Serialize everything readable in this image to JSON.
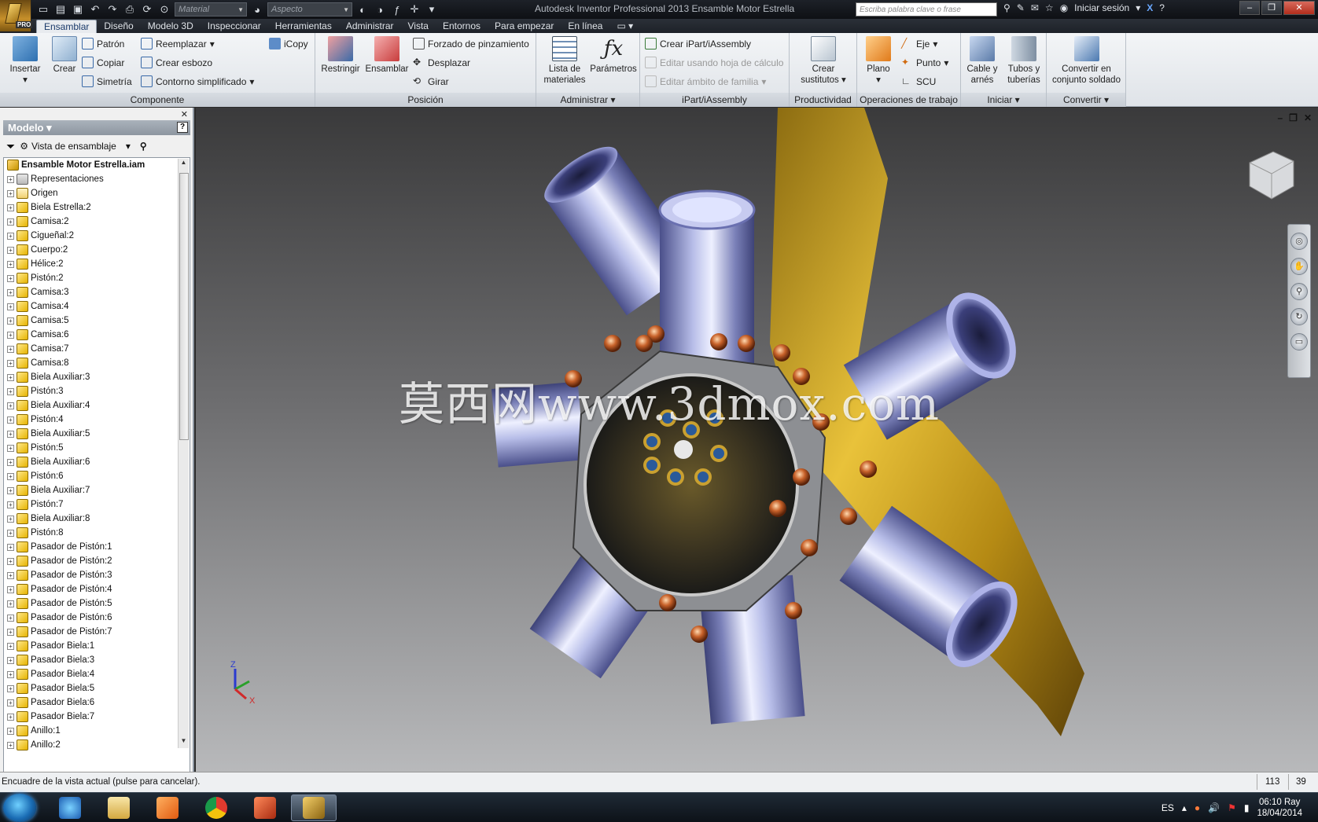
{
  "window": {
    "title": "Autodesk Inventor Professional 2013    Ensamble Motor Estrella",
    "app_badge": "PRO",
    "material_placeholder": "Material",
    "appearance_placeholder": "Aspecto",
    "search_placeholder": "Escriba palabra clave o frase",
    "sign_in": "Iniciar sesión"
  },
  "tabs": [
    "Ensamblar",
    "Diseño",
    "Modelo 3D",
    "Inspeccionar",
    "Herramientas",
    "Administrar",
    "Vista",
    "Entornos",
    "Para empezar",
    "En línea"
  ],
  "ribbon": {
    "componente": {
      "label": "Componente",
      "insertar": "Insertar",
      "crear": "Crear",
      "patron": "Patrón",
      "copiar": "Copiar",
      "simetria": "Simetría",
      "reemplazar": "Reemplazar",
      "crear_esbozo": "Crear esbozo",
      "contorno": "Contorno simplificado",
      "icopy": "iCopy"
    },
    "posicion": {
      "label": "Posición",
      "restringir": "Restringir",
      "ensamblar": "Ensamblar",
      "forzado": "Forzado de pinzamiento",
      "desplazar": "Desplazar",
      "girar": "Girar"
    },
    "administrar": {
      "label": "Administrar",
      "lista1": "Lista de",
      "lista2": "materiales",
      "parametros": "Parámetros"
    },
    "ipart": {
      "label": "iPart/iAssembly",
      "crear": "Crear iPart/iAssembly",
      "editar_hoja": "Editar usando hoja de cálculo",
      "editar_ambito": "Editar ámbito de familia"
    },
    "productividad": {
      "label": "Productividad",
      "crear1": "Crear",
      "crear2": "sustitutos"
    },
    "operaciones": {
      "label": "Operaciones de trabajo",
      "plano": "Plano",
      "eje": "Eje",
      "punto": "Punto",
      "scu": "SCU"
    },
    "iniciar": {
      "label": "Iniciar",
      "cable1": "Cable y",
      "cable2": "arnés",
      "tubos1": "Tubos y",
      "tubos2": "tuberías"
    },
    "convertir": {
      "label": "Convertir",
      "conv1": "Convertir en",
      "conv2": "conjunto soldado"
    }
  },
  "browser": {
    "title": "Modelo",
    "view_mode": "Vista de ensamblaje",
    "root": "Ensamble Motor Estrella.iam",
    "items": [
      "Representaciones",
      "Origen",
      "Biela Estrella:2",
      "Camisa:2",
      "Cigueñal:2",
      "Cuerpo:2",
      "Hélice:2",
      "Pistón:2",
      "Camisa:3",
      "Camisa:4",
      "Camisa:5",
      "Camisa:6",
      "Camisa:7",
      "Camisa:8",
      "Biela Auxiliar:3",
      "Pistón:3",
      "Biela Auxiliar:4",
      "Pistón:4",
      "Biela Auxiliar:5",
      "Pistón:5",
      "Biela Auxiliar:6",
      "Pistón:6",
      "Biela Auxiliar:7",
      "Pistón:7",
      "Biela Auxiliar:8",
      "Pistón:8",
      "Pasador de Pistón:1",
      "Pasador de Pistón:2",
      "Pasador de Pistón:3",
      "Pasador de Pistón:4",
      "Pasador de Pistón:5",
      "Pasador de Pistón:6",
      "Pasador de Pistón:7",
      "Pasador Biela:1",
      "Pasador Biela:3",
      "Pasador Biela:4",
      "Pasador Biela:5",
      "Pasador Biela:6",
      "Pasador Biela:7",
      "Anillo:1",
      "Anillo:2"
    ]
  },
  "viewport": {
    "watermark": "莫西网www.3dmox.com",
    "axis_z": "Z",
    "axis_x": "X"
  },
  "status": {
    "message": "Encuadre de la vista actual (pulse para cancelar).",
    "count1": "113",
    "count2": "39"
  },
  "taskbar": {
    "language": "ES",
    "time": "06:10 Ray",
    "date": "18/04/2014"
  }
}
